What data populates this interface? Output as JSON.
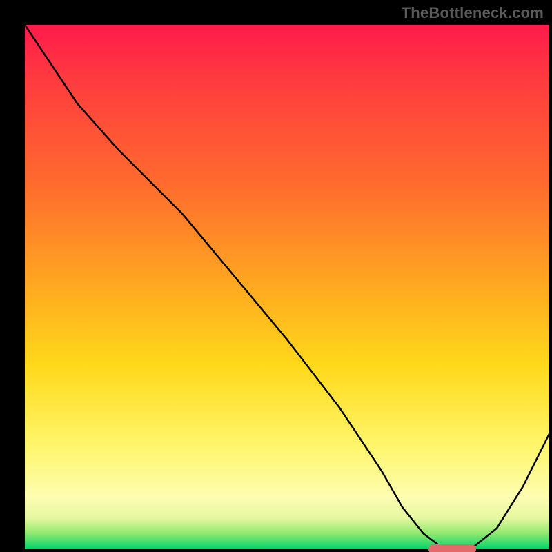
{
  "watermark": "TheBottleneck.com",
  "chart_data": {
    "type": "line",
    "title": "",
    "xlabel": "",
    "ylabel": "",
    "xlim": [
      0,
      100
    ],
    "ylim": [
      0,
      100
    ],
    "grid": false,
    "legend": false,
    "series": [
      {
        "name": "curve",
        "x": [
          0,
          4,
          10,
          18,
          24,
          30,
          40,
          50,
          60,
          68,
          72,
          76,
          80,
          85,
          90,
          95,
          100
        ],
        "y": [
          100,
          94,
          85,
          76,
          70,
          64,
          52,
          40,
          27,
          15,
          8,
          3,
          0,
          0,
          4,
          12,
          22
        ]
      }
    ],
    "annotations": [
      {
        "name": "bottleneck-marker",
        "x_range": [
          77,
          86
        ],
        "y": 0,
        "color": "#e26a6a"
      }
    ],
    "background_gradient": {
      "direction": "vertical",
      "stops": [
        {
          "pos": 0,
          "color": "#ff1b4b"
        },
        {
          "pos": 30,
          "color": "#ff6a2e"
        },
        {
          "pos": 65,
          "color": "#ffd91a"
        },
        {
          "pos": 90,
          "color": "#fdfdb0"
        },
        {
          "pos": 100,
          "color": "#00d46a"
        }
      ]
    }
  }
}
